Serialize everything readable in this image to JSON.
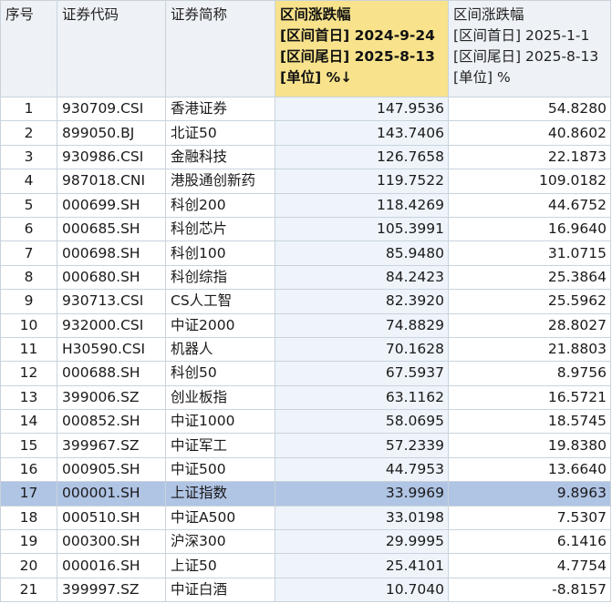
{
  "columns": {
    "index": "序号",
    "code": "证券代码",
    "name": "证券简称",
    "v1": {
      "title": "区间涨跌幅",
      "start": "[区间首日] 2024-9-24",
      "end": "[区间尾日] 2025-8-13",
      "unit": "[单位] %",
      "sort_arrow": "↓"
    },
    "v2": {
      "title": "区间涨跌幅",
      "start": "[区间首日] 2025-1-1",
      "end": "[区间尾日] 2025-8-13",
      "unit": "[单位] %"
    }
  },
  "rows": [
    {
      "idx": "1",
      "code": "930709.CSI",
      "name": "香港证券",
      "v1": "147.9536",
      "v2": "54.8280"
    },
    {
      "idx": "2",
      "code": "899050.BJ",
      "name": "北证50",
      "v1": "143.7406",
      "v2": "40.8602"
    },
    {
      "idx": "3",
      "code": "930986.CSI",
      "name": "金融科技",
      "v1": "126.7658",
      "v2": "22.1873"
    },
    {
      "idx": "4",
      "code": "987018.CNI",
      "name": "港股通创新药",
      "v1": "119.7522",
      "v2": "109.0182"
    },
    {
      "idx": "5",
      "code": "000699.SH",
      "name": "科创200",
      "v1": "118.4269",
      "v2": "44.6752"
    },
    {
      "idx": "6",
      "code": "000685.SH",
      "name": "科创芯片",
      "v1": "105.3991",
      "v2": "16.9640"
    },
    {
      "idx": "7",
      "code": "000698.SH",
      "name": "科创100",
      "v1": "85.9480",
      "v2": "31.0715"
    },
    {
      "idx": "8",
      "code": "000680.SH",
      "name": "科创综指",
      "v1": "84.2423",
      "v2": "25.3864"
    },
    {
      "idx": "9",
      "code": "930713.CSI",
      "name": "CS人工智",
      "v1": "82.3920",
      "v2": "25.5962"
    },
    {
      "idx": "10",
      "code": "932000.CSI",
      "name": "中证2000",
      "v1": "74.8829",
      "v2": "28.8027"
    },
    {
      "idx": "11",
      "code": "H30590.CSI",
      "name": "机器人",
      "v1": "70.1628",
      "v2": "21.8803"
    },
    {
      "idx": "12",
      "code": "000688.SH",
      "name": "科创50",
      "v1": "67.5937",
      "v2": "8.9756"
    },
    {
      "idx": "13",
      "code": "399006.SZ",
      "name": "创业板指",
      "v1": "63.1162",
      "v2": "16.5721"
    },
    {
      "idx": "14",
      "code": "000852.SH",
      "name": "中证1000",
      "v1": "58.0695",
      "v2": "18.5745"
    },
    {
      "idx": "15",
      "code": "399967.SZ",
      "name": "中证军工",
      "v1": "57.2339",
      "v2": "19.8380"
    },
    {
      "idx": "16",
      "code": "000905.SH",
      "name": "中证500",
      "v1": "44.7953",
      "v2": "13.6640"
    },
    {
      "idx": "17",
      "code": "000001.SH",
      "name": "上证指数",
      "v1": "33.9969",
      "v2": "9.8963",
      "selected": true
    },
    {
      "idx": "18",
      "code": "000510.SH",
      "name": "中证A500",
      "v1": "33.0198",
      "v2": "7.5307"
    },
    {
      "idx": "19",
      "code": "000300.SH",
      "name": "沪深300",
      "v1": "29.9995",
      "v2": "6.1416"
    },
    {
      "idx": "20",
      "code": "000016.SH",
      "name": "上证50",
      "v1": "25.4101",
      "v2": "4.7754"
    },
    {
      "idx": "21",
      "code": "399997.SZ",
      "name": "中证白酒",
      "v1": "10.7040",
      "v2": "-8.8157"
    }
  ],
  "colors": {
    "sorted_header": "#f8e38c",
    "selected_row": "#b0c4e4",
    "grid_line": "#c9d3dc"
  }
}
